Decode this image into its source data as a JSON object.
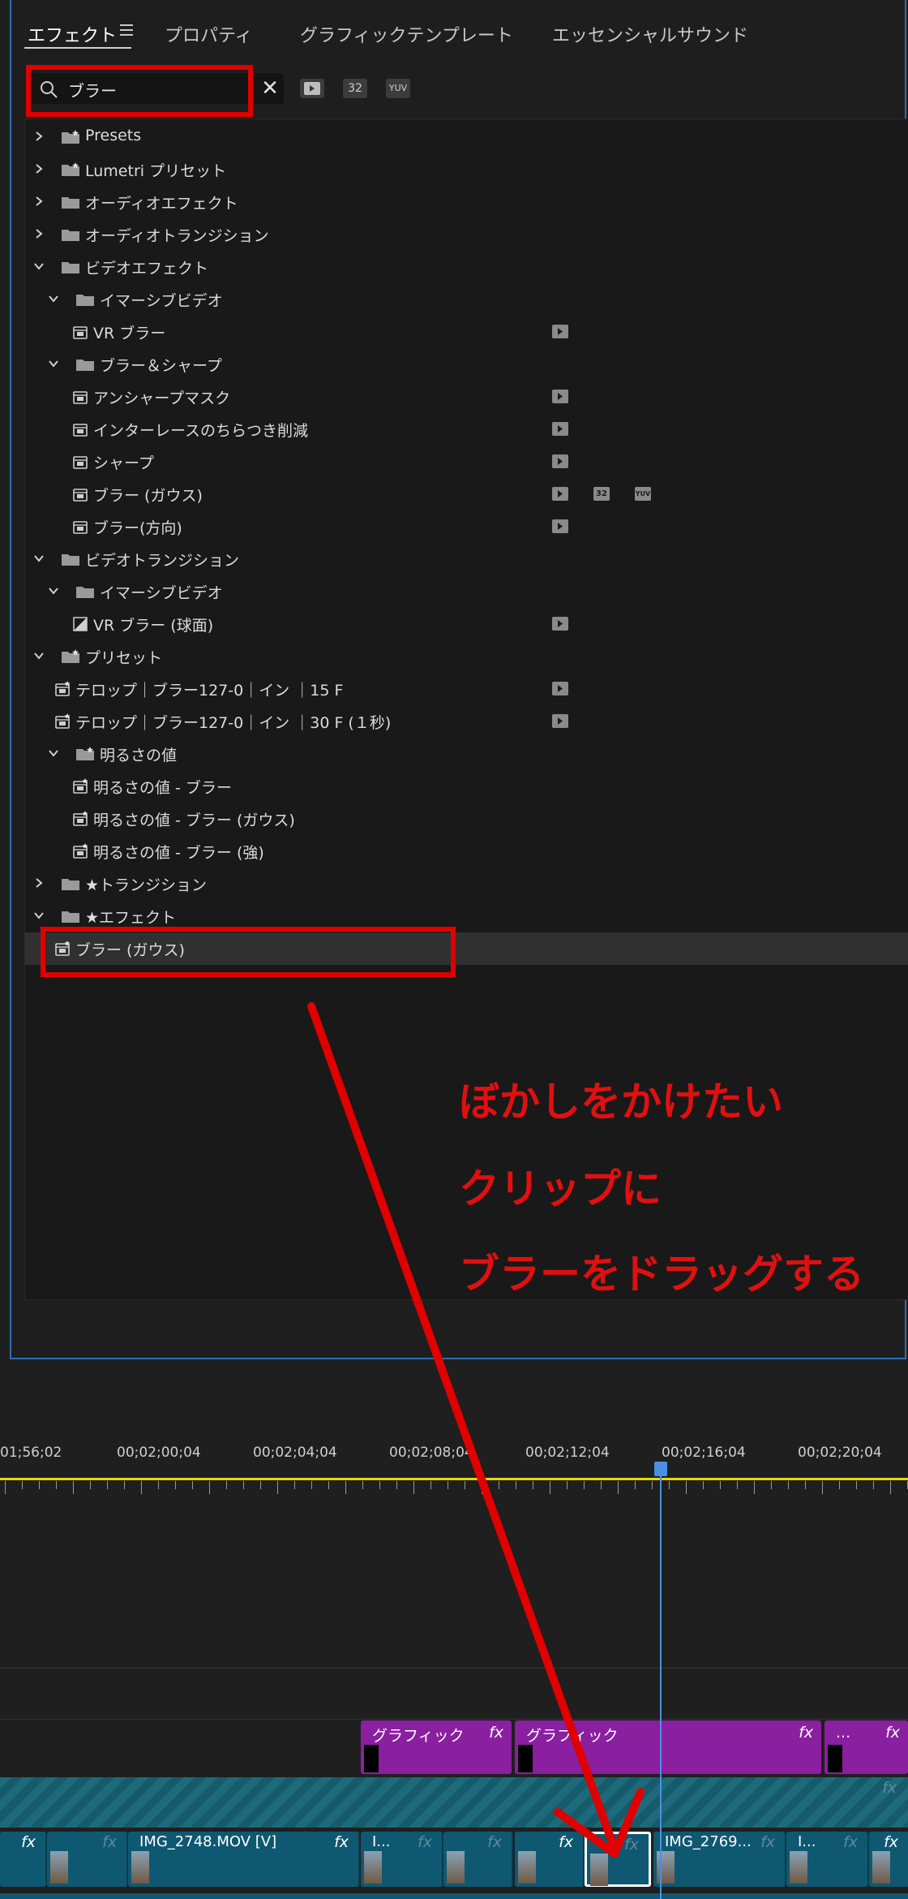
{
  "tabs": [
    {
      "label": "エフェクト",
      "active": true
    },
    {
      "label": "プロパティ",
      "active": false
    },
    {
      "label": "グラフィックテンプレート",
      "active": false
    },
    {
      "label": "エッセンシャルサウンド",
      "active": false
    }
  ],
  "search": {
    "value": "ブラー"
  },
  "toolbar": {
    "accel_label": "",
    "bit32_label": "32",
    "yuv_label": "YUV"
  },
  "tree": [
    {
      "label": "Presets",
      "type": "preset-folder",
      "expanded": false,
      "level": 0
    },
    {
      "label": "Lumetri プリセット",
      "type": "preset-folder",
      "expanded": false,
      "level": 0
    },
    {
      "label": "オーディオエフェクト",
      "type": "folder",
      "expanded": false,
      "level": 0
    },
    {
      "label": "オーディオトランジション",
      "type": "folder",
      "expanded": false,
      "level": 0
    },
    {
      "label": "ビデオエフェクト",
      "type": "folder",
      "expanded": true,
      "level": 0
    },
    {
      "label": "イマーシブビデオ",
      "type": "folder",
      "expanded": true,
      "level": 1
    },
    {
      "label": "VR ブラー",
      "type": "effect",
      "level": 2,
      "badges": [
        "accel"
      ]
    },
    {
      "label": "ブラー＆シャープ",
      "type": "folder",
      "expanded": true,
      "level": 1
    },
    {
      "label": "アンシャープマスク",
      "type": "effect",
      "level": 2,
      "badges": [
        "accel"
      ]
    },
    {
      "label": "インターレースのちらつき削減",
      "type": "effect",
      "level": 2,
      "badges": [
        "accel"
      ]
    },
    {
      "label": "シャープ",
      "type": "effect",
      "level": 2,
      "badges": [
        "accel"
      ]
    },
    {
      "label": "ブラー (ガウス)",
      "type": "effect",
      "level": 2,
      "badges": [
        "accel",
        "32",
        "YUV"
      ]
    },
    {
      "label": "ブラー(方向)",
      "type": "effect",
      "level": 2,
      "badges": [
        "accel"
      ]
    },
    {
      "label": "ビデオトランジション",
      "type": "folder",
      "expanded": true,
      "level": 0
    },
    {
      "label": "イマーシブビデオ",
      "type": "folder",
      "expanded": true,
      "level": 1
    },
    {
      "label": "VR ブラー (球面)",
      "type": "transition",
      "level": 2,
      "badges": [
        "accel"
      ]
    },
    {
      "label": "プリセット",
      "type": "preset-folder",
      "expanded": true,
      "level": 0
    },
    {
      "label": "テロップ｜ブラー127-0｜イン ｜15 F",
      "type": "preset",
      "level": 1,
      "badges": [
        "accel"
      ]
    },
    {
      "label": "テロップ｜ブラー127-0｜イン ｜30 F (１秒)",
      "type": "preset",
      "level": 1,
      "badges": [
        "accel"
      ]
    },
    {
      "label": "明るさの値",
      "type": "preset-folder",
      "expanded": true,
      "level": 1
    },
    {
      "label": "明るさの値 - ブラー",
      "type": "preset",
      "level": 2
    },
    {
      "label": "明るさの値 - ブラー (ガウス)",
      "type": "preset",
      "level": 2
    },
    {
      "label": "明るさの値 - ブラー (強)",
      "type": "preset",
      "level": 2
    },
    {
      "label": "★トランジション",
      "type": "folder",
      "expanded": false,
      "level": 0
    },
    {
      "label": "★エフェクト",
      "type": "folder",
      "expanded": true,
      "level": 0
    },
    {
      "label": "ブラー (ガウス)",
      "type": "preset-effect",
      "level": 1,
      "selected": true
    }
  ],
  "annotation": {
    "lines": [
      "ぼかしをかけたい",
      "クリップに",
      "ブラーをドラッグする"
    ],
    "color": "#e01010"
  },
  "timeline": {
    "timecodes": [
      "01;56;02",
      "00;02;00;04",
      "00;02;04;04",
      "00;02;08;04",
      "00;02;12;04",
      "00;02;16;04",
      "00;02;20;04"
    ],
    "graphic_clips": [
      {
        "name": "グラフィック",
        "fx": "fx"
      },
      {
        "name": "グラフィック",
        "fx": "fx"
      },
      {
        "name": "...",
        "fx": "fx"
      }
    ],
    "track_fx": "fx",
    "video_clips": [
      {
        "name": "",
        "fx": "fx"
      },
      {
        "name": "",
        "fx": "fx"
      },
      {
        "name": "IMG_2748.MOV [V]",
        "fx": "fx"
      },
      {
        "name": "I...",
        "fx": "fx"
      },
      {
        "name": "",
        "fx": "fx"
      },
      {
        "name": "",
        "fx": "fx"
      },
      {
        "name": "",
        "fx": "fx"
      },
      {
        "name": "IMG_2769...",
        "fx": "fx"
      },
      {
        "name": "I...",
        "fx": "fx"
      },
      {
        "name": "",
        "fx": "fx"
      }
    ]
  },
  "colors": {
    "accent": "#2d6db8",
    "highlight": "#e00000",
    "graphic_clip": "#8a1fa0",
    "video_clip": "#0f5872",
    "ruler": "#e6d800",
    "playhead": "#4a90e2"
  }
}
